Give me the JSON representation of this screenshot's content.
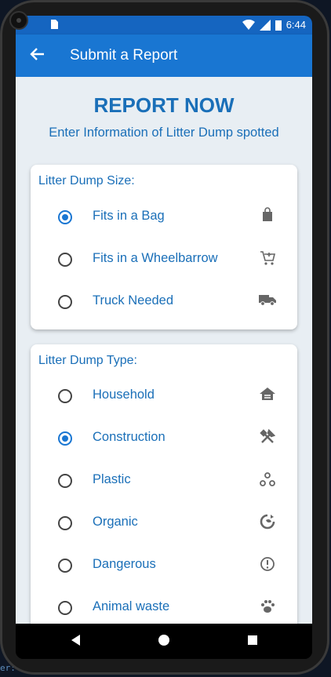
{
  "status": {
    "time": "6:44"
  },
  "appbar": {
    "title": "Submit a Report"
  },
  "header": {
    "title": "REPORT NOW",
    "subtitle": "Enter Information of Litter Dump spotted"
  },
  "size_card": {
    "title": "Litter Dump Size:",
    "options": [
      {
        "label": "Fits in a Bag",
        "selected": true,
        "icon": "bag-icon"
      },
      {
        "label": "Fits in a Wheelbarrow",
        "selected": false,
        "icon": "cart-icon"
      },
      {
        "label": "Truck Needed",
        "selected": false,
        "icon": "truck-icon"
      }
    ]
  },
  "type_card": {
    "title": "Litter Dump Type:",
    "options": [
      {
        "label": "Household",
        "selected": false,
        "icon": "house-icon"
      },
      {
        "label": "Construction",
        "selected": true,
        "icon": "tools-icon"
      },
      {
        "label": "Plastic",
        "selected": false,
        "icon": "molecule-icon"
      },
      {
        "label": "Organic",
        "selected": false,
        "icon": "compost-icon"
      },
      {
        "label": "Dangerous",
        "selected": false,
        "icon": "warning-icon"
      },
      {
        "label": "Animal waste",
        "selected": false,
        "icon": "paw-icon"
      }
    ]
  },
  "colors": {
    "primary": "#1976d2",
    "accent_text": "#1a6fb8",
    "background": "#e8eef3"
  }
}
